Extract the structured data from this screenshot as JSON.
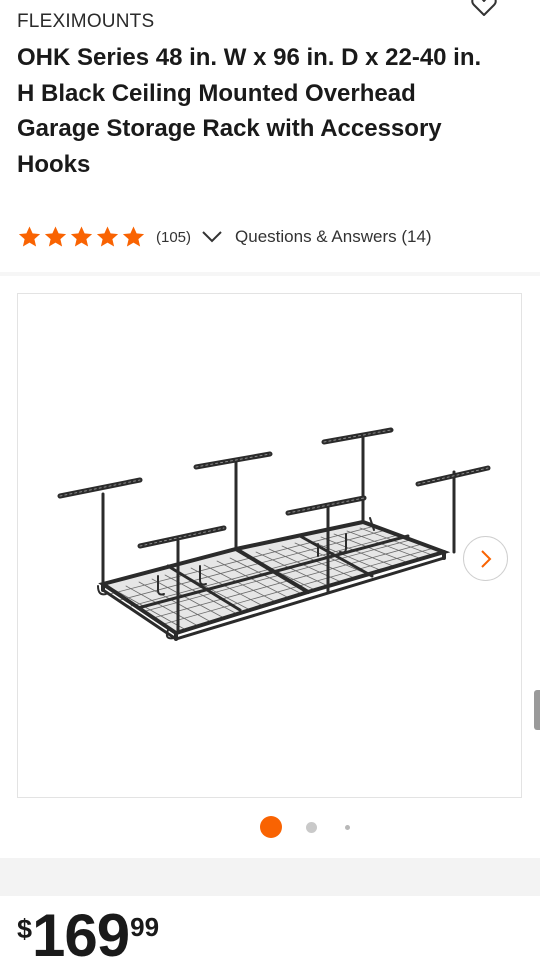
{
  "product": {
    "brand": "FLEXIMOUNTS",
    "title": "OHK Series 48 in. W x 96 in. D x 22-40 in. H Black Ceiling Mounted Overhead Garage Storage Rack with Accessory Hooks",
    "rating": {
      "stars": 5,
      "count_label": "(105)",
      "qa_label": "Questions & Answers (14)"
    },
    "price": {
      "currency": "$",
      "dollars": "169",
      "cents": "99"
    }
  },
  "gallery": {
    "image_icon": "ceiling-storage-rack-image",
    "active_index": 1,
    "total_dots": 3
  },
  "colors": {
    "accent": "#f96302",
    "star": "#f96302",
    "rack": "#2b2b2b"
  }
}
